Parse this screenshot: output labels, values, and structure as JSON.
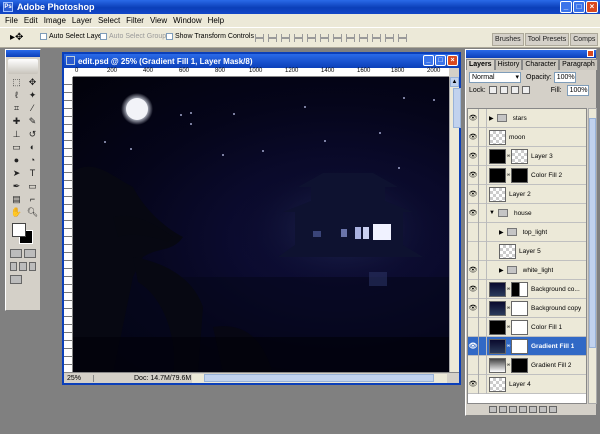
{
  "app": {
    "title": "Adobe Photoshop",
    "icon": "ps-app-icon"
  },
  "window_buttons": [
    "_",
    "□",
    "×"
  ],
  "menu": [
    "File",
    "Edit",
    "Image",
    "Layer",
    "Select",
    "Filter",
    "View",
    "Window",
    "Help"
  ],
  "options": {
    "tool_icon": "move-tool-icon",
    "tool_glyph": "▸✥",
    "auto_select_layer": "Auto Select Layer",
    "auto_select_groups": "Auto Select Groups",
    "show_transform_controls": "Show Transform Controls",
    "palette_well_tabs": [
      "Brushes",
      "Tool Presets",
      "Comps"
    ]
  },
  "document": {
    "title": "edit.psd @ 25% (Gradient Fill 1, Layer Mask/8)",
    "ruler_ticks": [
      "0",
      "200",
      "400",
      "600",
      "800",
      "1000",
      "1200",
      "1400",
      "1600",
      "1800",
      "2000"
    ],
    "zoom": "25%",
    "doc_info": "Doc: 14.7M/79.6M",
    "buttons": [
      "_",
      "□",
      "×"
    ]
  },
  "layers_panel": {
    "tabs": [
      "Layers",
      "History",
      "Character",
      "Paragraph"
    ],
    "blend_mode": "Normal",
    "opacity_label": "Opacity:",
    "opacity": "100%",
    "lock_label": "Lock:",
    "fill_label": "Fill:",
    "fill": "100%",
    "layers": [
      {
        "name": "stars",
        "kind": "group",
        "visible": true,
        "indent": 0,
        "expanded": false
      },
      {
        "name": "moon",
        "kind": "layer",
        "visible": true,
        "thumb": "checker",
        "indent": 0
      },
      {
        "name": "Layer 3",
        "kind": "layer",
        "visible": true,
        "thumb": "black",
        "mask": "checker",
        "indent": 0
      },
      {
        "name": "Color Fill 2",
        "kind": "fill",
        "visible": true,
        "thumb": "black",
        "mask": "black",
        "indent": 0
      },
      {
        "name": "Layer 2",
        "kind": "layer",
        "visible": true,
        "thumb": "checker",
        "indent": 0
      },
      {
        "name": "house",
        "kind": "group",
        "visible": true,
        "indent": 0,
        "expanded": true
      },
      {
        "name": "top_light",
        "kind": "group",
        "visible": false,
        "indent": 1,
        "expanded": false
      },
      {
        "name": "Layer 5",
        "kind": "layer",
        "visible": false,
        "thumb": "checker",
        "indent": 1
      },
      {
        "name": "white_light",
        "kind": "group",
        "visible": true,
        "indent": 1,
        "expanded": false
      },
      {
        "name": "Background co...",
        "kind": "layer",
        "visible": true,
        "thumb": "night",
        "mask": "bwmask",
        "indent": 0
      },
      {
        "name": "Background copy",
        "kind": "layer",
        "visible": true,
        "thumb": "night",
        "mask": "white",
        "indent": 0
      },
      {
        "name": "Color Fill 1",
        "kind": "fill",
        "visible": false,
        "thumb": "black",
        "mask": "white",
        "indent": 0
      },
      {
        "name": "Gradient Fill 1",
        "kind": "fill",
        "visible": true,
        "thumb": "night",
        "mask": "white",
        "indent": 0,
        "selected": true
      },
      {
        "name": "Gradient Fill 2",
        "kind": "fill",
        "visible": false,
        "thumb": "gradmask",
        "mask": "black",
        "indent": 0
      },
      {
        "name": "Layer 4",
        "kind": "layer",
        "visible": true,
        "thumb": "checker",
        "indent": 0
      }
    ]
  },
  "colors": {
    "titlebar_blue": "#0b3fb9",
    "selected_layer": "#3169c6",
    "chrome": "#d4d0c8",
    "night_sky": "#05051a",
    "foreground": "#ffffff",
    "background": "#000000"
  }
}
